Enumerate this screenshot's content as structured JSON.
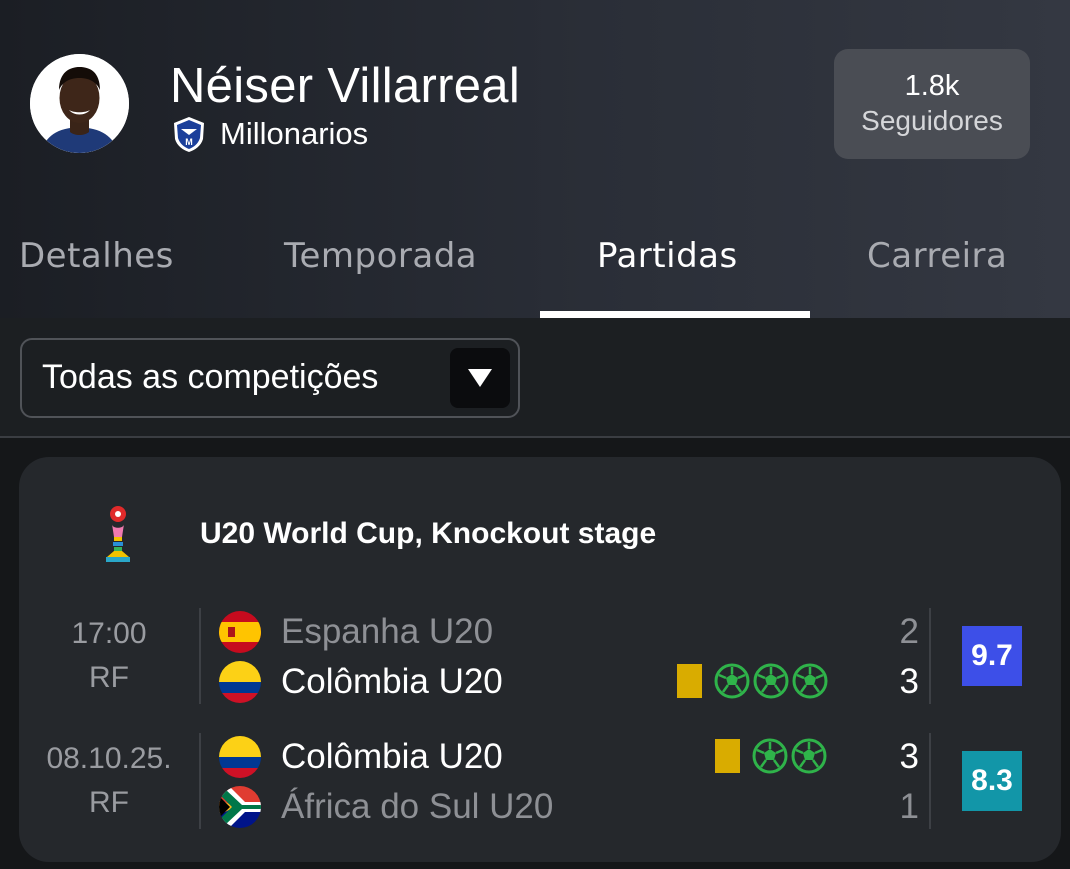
{
  "player": {
    "name": "Néiser Villarreal",
    "team": "Millonarios",
    "followers_count": "1.8k",
    "followers_label": "Seguidores"
  },
  "tabs": [
    {
      "label": "Detalhes",
      "active": false
    },
    {
      "label": "Temporada",
      "active": false
    },
    {
      "label": "Partidas",
      "active": true
    },
    {
      "label": "Carreira",
      "active": false
    }
  ],
  "filter": {
    "selected": "Todas as competições"
  },
  "competition": {
    "title": "U20 World Cup, Knockout stage",
    "icon": "world-cup-trophy-icon"
  },
  "matches": [
    {
      "time": "17:00",
      "status": "RF",
      "home": {
        "name": "Espanha U20",
        "score": "2",
        "flag": "spain-flag-icon"
      },
      "away": {
        "name": "Colômbia U20",
        "score": "3",
        "flag": "colombia-flag-icon"
      },
      "events_team": "away",
      "yellow_cards": 1,
      "goals": 3,
      "rating": "9.7",
      "rating_color": "#3d4fe8"
    },
    {
      "time": "08.10.25.",
      "status": "RF",
      "home": {
        "name": "Colômbia U20",
        "score": "3",
        "flag": "colombia-flag-icon"
      },
      "away": {
        "name": "África do Sul U20",
        "score": "1",
        "flag": "south-africa-flag-icon"
      },
      "events_team": "home",
      "yellow_cards": 1,
      "goals": 2,
      "rating": "8.3",
      "rating_color": "#1296a8"
    }
  ],
  "colors": {
    "yellow_card": "#d9ac00",
    "goal_ball": "#2fb34a",
    "background": "#151719",
    "card": "#25282c"
  }
}
